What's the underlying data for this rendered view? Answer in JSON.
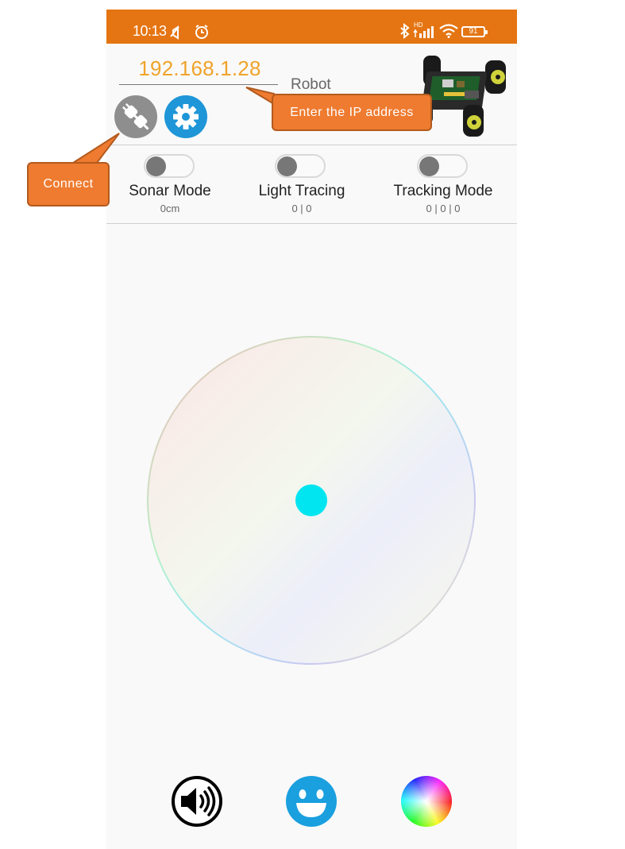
{
  "status_bar": {
    "time": "10:13",
    "battery": "91",
    "network": "HD",
    "color": "#e57512"
  },
  "connection": {
    "ip_value": "192.168.1.28",
    "robot_name": "Robot"
  },
  "modes": [
    {
      "label": "Sonar Mode",
      "value": "0cm",
      "enabled": false
    },
    {
      "label": "Light Tracing",
      "value": "0 | 0",
      "enabled": false
    },
    {
      "label": "Tracking Mode",
      "value": "0 | 0 | 0",
      "enabled": false
    }
  ],
  "annotations": {
    "ip_callout": "Enter the IP address",
    "connect_callout": "Connect"
  },
  "colors": {
    "accent_orange": "#e57512",
    "ip_text": "#f0a32a",
    "settings_blue": "#1e96d7",
    "joystick_knob": "#00e5f0"
  },
  "bottom_bar": {
    "icons": [
      "sound-icon",
      "smiley-icon",
      "color-wheel-icon"
    ]
  }
}
